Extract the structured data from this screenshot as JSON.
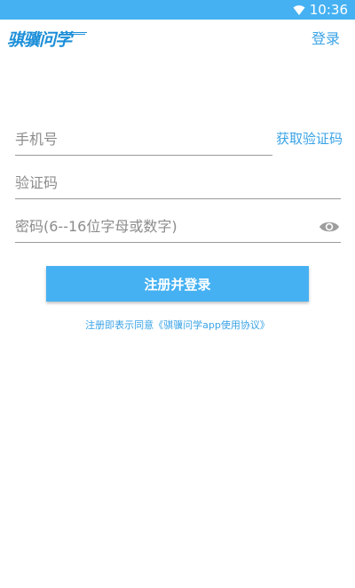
{
  "status_bar": {
    "time": "10:36",
    "wifi_icon": "wifi-icon"
  },
  "header": {
    "logo_text": "骐骥问学",
    "login_label": "登录"
  },
  "form": {
    "phone_placeholder": "手机号",
    "get_code_label": "获取验证码",
    "code_placeholder": "验证码",
    "password_placeholder": "密码(6--16位字母或数字)",
    "eye_icon": "eye-icon",
    "submit_label": "注册并登录"
  },
  "agreement": {
    "text": "注册即表示同意《骐骥问学app使用协议》"
  },
  "colors": {
    "accent": "#46b1f2",
    "link": "#3aa3e6"
  }
}
